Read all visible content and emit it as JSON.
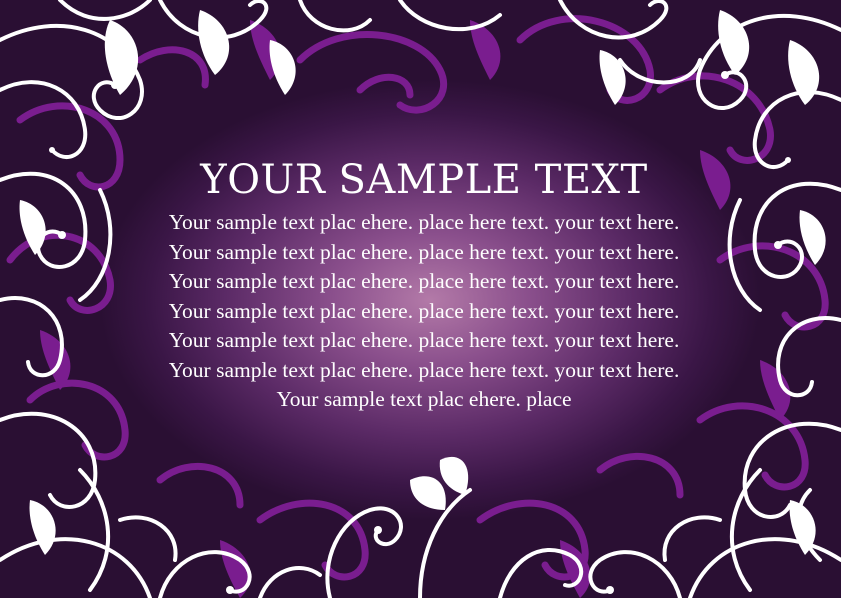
{
  "card": {
    "title": "YOUR SAMPLE TEXT",
    "body": "Your sample text plac ehere. place here text. your text here. Your sample text plac ehere. place here text. your text here. Your sample text plac ehere. place here text. your text here. Your sample text plac ehere. place here text. your text here. Your sample text plac ehere. place here text. your text here. Your sample text plac ehere. place here text. your text here. Your sample text plac ehere. place"
  },
  "colors": {
    "text": "#ffffff",
    "ornament_white": "#ffffff",
    "ornament_purple": "#7a1d8f",
    "background_center": "#b37aa8",
    "background_edge": "#2a0f33"
  }
}
